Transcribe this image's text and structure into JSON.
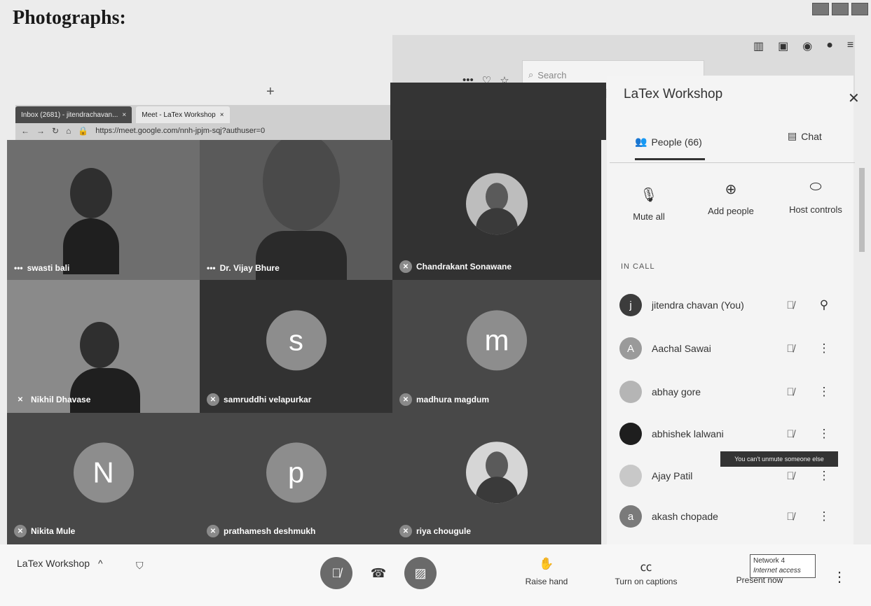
{
  "document": {
    "heading": "Photographs:"
  },
  "browser": {
    "tabs": [
      {
        "label": "Inbox (2681) - jitendrachavan...",
        "close": "×"
      },
      {
        "label": "Meet - LaTex Workshop",
        "close": "×"
      }
    ],
    "new_tab": "+",
    "url": "https://meet.google.com/nnh-jpjm-sqj?authuser=0",
    "search_placeholder": "Search",
    "page_actions": [
      "•••",
      "♡",
      "☆"
    ]
  },
  "tiles": [
    {
      "name": "swasti bali",
      "type": "video",
      "prefix": "•••"
    },
    {
      "name": "Dr. Vijay Bhure",
      "type": "video",
      "prefix": "•••"
    },
    {
      "name": "Chandrakant Sonawane",
      "type": "photo"
    },
    {
      "name": "Nikhil Dhavase",
      "type": "video"
    },
    {
      "name": "samruddhi velapurkar",
      "type": "letter",
      "letter": "s"
    },
    {
      "name": "madhura magdum",
      "type": "letter",
      "letter": "m"
    },
    {
      "name": "Nikita Mule",
      "type": "letter",
      "letter": "N"
    },
    {
      "name": "prathamesh deshmukh",
      "type": "letter",
      "letter": "p"
    },
    {
      "name": "riya chougule",
      "type": "photo"
    }
  ],
  "panel": {
    "title": "LaTex Workshop",
    "tab_people": "People (66)",
    "tab_chat": "Chat",
    "actions": {
      "mute_all": "Mute all",
      "add_people": "Add people",
      "host_controls": "Host controls"
    },
    "section": "IN CALL",
    "participants": [
      {
        "name": "jitendra chavan (You)",
        "avatar_letter": "j",
        "avatar_color": "#3c3c3c"
      },
      {
        "name": "Aachal Sawai",
        "avatar_letter": "A",
        "avatar_color": "#9a9a9a"
      },
      {
        "name": "abhay gore",
        "avatar_letter": "",
        "avatar_color": "#b5b5b5"
      },
      {
        "name": "abhishek lalwani",
        "avatar_letter": "",
        "avatar_color": "#1e1e1e"
      },
      {
        "name": "Ajay Patil",
        "avatar_letter": "",
        "avatar_color": "#c8c8c8"
      },
      {
        "name": "akash chopade",
        "avatar_letter": "a",
        "avatar_color": "#7a7a7a"
      }
    ],
    "tooltip": "You can't unmute someone else"
  },
  "bottom": {
    "meeting_name": "LaTex Workshop",
    "raise_hand": "Raise hand",
    "captions": "Turn on captions",
    "present": "Present now",
    "network_line1": "Network 4",
    "network_line2": "Internet access"
  }
}
